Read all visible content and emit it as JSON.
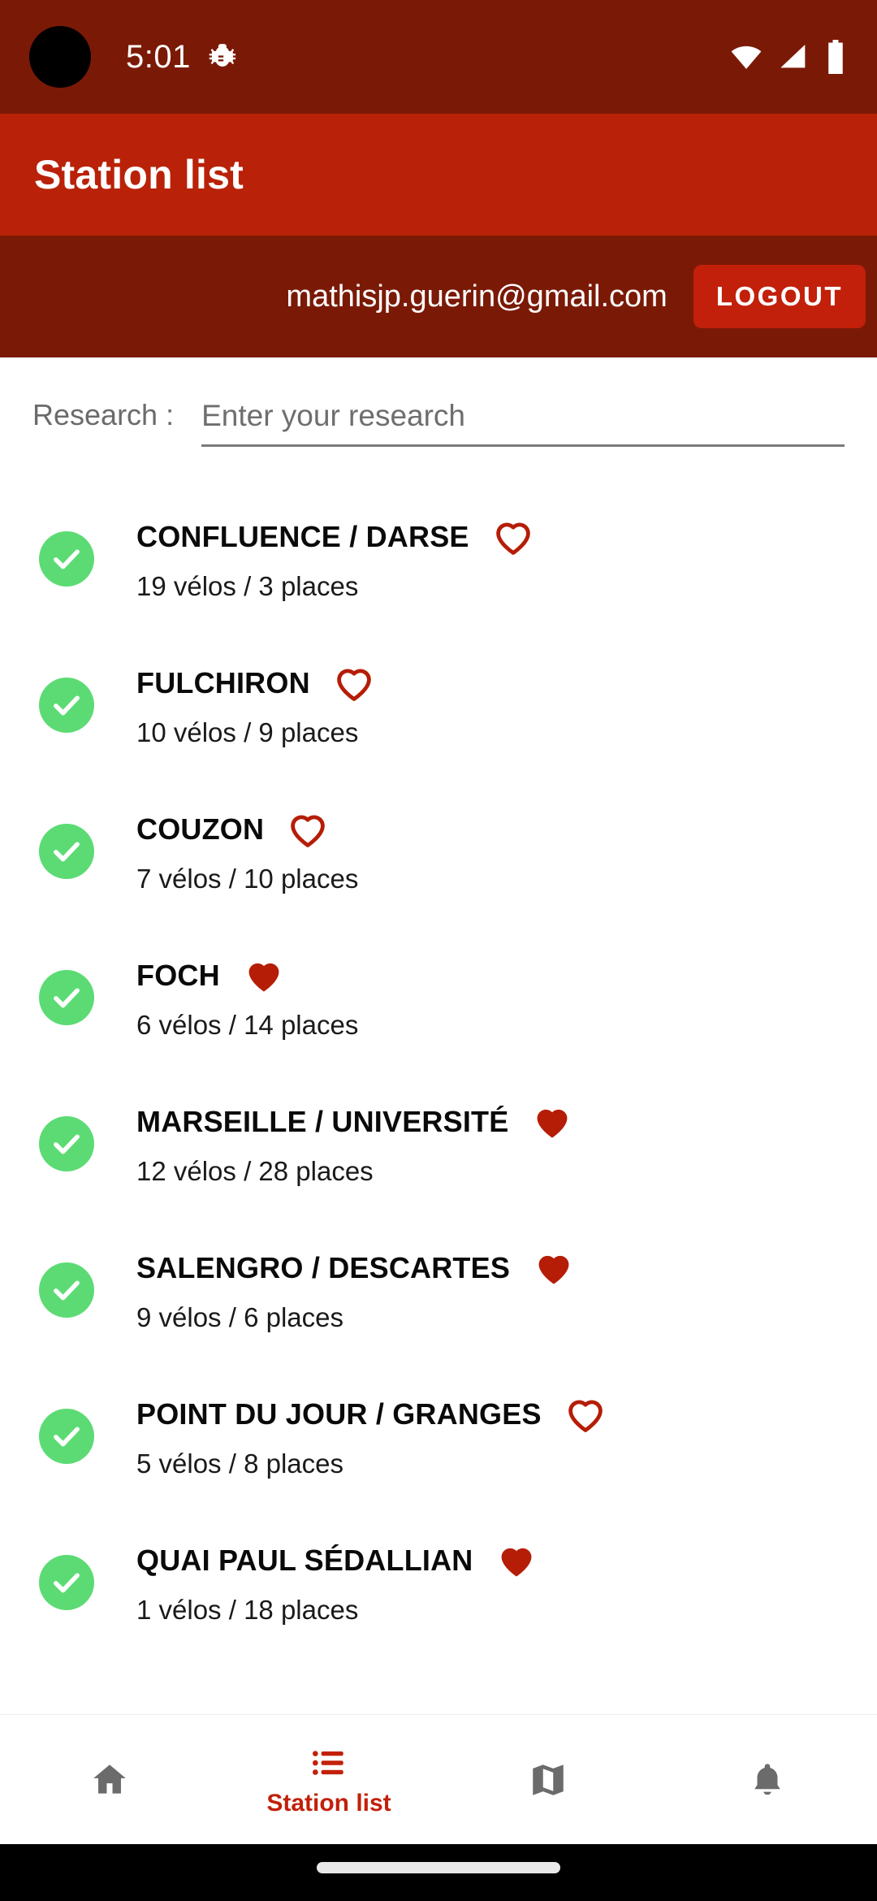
{
  "status_bar": {
    "time": "5:01",
    "icons": [
      "bug-icon",
      "wifi-icon",
      "cellular-signal-icon",
      "battery-icon"
    ],
    "background_color": "#7A1A06"
  },
  "app_bar": {
    "title": "Station list",
    "background_color": "#B92208"
  },
  "account_bar": {
    "email": "mathisjp.guerin@gmail.com",
    "logout_label": "LOGOUT",
    "background_color": "#7A1A06",
    "button_color": "#C2200A"
  },
  "search": {
    "label": "Research :",
    "value": "",
    "placeholder": "Enter your research"
  },
  "stations": [
    {
      "name": "CONFLUENCE / DARSE",
      "availability": "19 vélos  /  3 places",
      "bikes": 19,
      "places": 3,
      "status": "available",
      "favorite": false
    },
    {
      "name": "FULCHIRON",
      "availability": "10 vélos  /  9 places",
      "bikes": 10,
      "places": 9,
      "status": "available",
      "favorite": false
    },
    {
      "name": "COUZON",
      "availability": "7 vélos  /  10 places",
      "bikes": 7,
      "places": 10,
      "status": "available",
      "favorite": false
    },
    {
      "name": "FOCH",
      "availability": "6 vélos  /  14 places",
      "bikes": 6,
      "places": 14,
      "status": "available",
      "favorite": true
    },
    {
      "name": "MARSEILLE / UNIVERSITÉ",
      "availability": "12 vélos  /  28 places",
      "bikes": 12,
      "places": 28,
      "status": "available",
      "favorite": true
    },
    {
      "name": "SALENGRO / DESCARTES",
      "availability": "9 vélos  /  6 places",
      "bikes": 9,
      "places": 6,
      "status": "available",
      "favorite": true
    },
    {
      "name": "POINT DU JOUR / GRANGES",
      "availability": "5 vélos  /  8 places",
      "bikes": 5,
      "places": 8,
      "status": "available",
      "favorite": false
    },
    {
      "name": "QUAI PAUL SÉDALLIAN",
      "availability": "1 vélos  /  18 places",
      "bikes": 1,
      "places": 18,
      "status": "available",
      "favorite": true
    }
  ],
  "bottom_nav": {
    "items": [
      {
        "icon": "home-icon",
        "label": "",
        "active": false
      },
      {
        "icon": "list-icon",
        "label": "Station list",
        "active": true
      },
      {
        "icon": "map-icon",
        "label": "",
        "active": false
      },
      {
        "icon": "bell-icon",
        "label": "",
        "active": false
      }
    ],
    "active_color": "#C2200A",
    "inactive_color": "#6b6b6b"
  },
  "colors": {
    "primary_red": "#B92208",
    "dark_red": "#7A1A06",
    "accent_red": "#C2200A",
    "heart_red": "#B51D06",
    "available_green": "#5CDB74"
  }
}
